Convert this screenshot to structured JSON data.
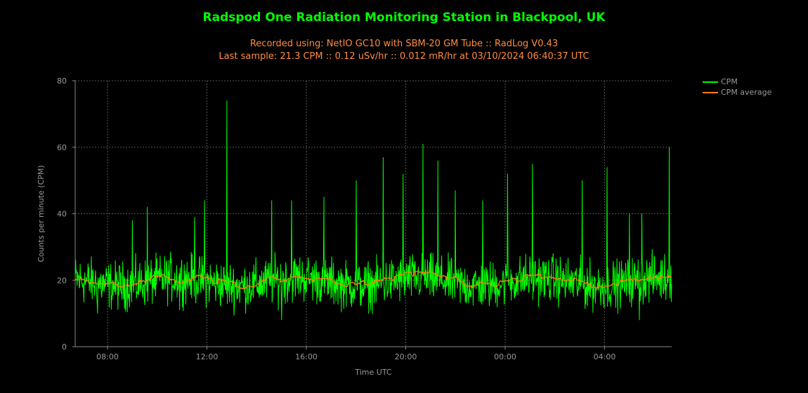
{
  "chart_data": {
    "type": "line",
    "title": "Radspod One Radiation Monitoring Station in Blackpool, UK",
    "subtitle_line1": "Recorded using: NetIO GC10 with SBM-20 GM Tube :: RadLog V0.43",
    "subtitle_line2": "Last sample: 21.3 CPM :: 0.12 uSv/hr :: 0.012 mR/hr at 03/10/2024 06:40:37 UTC",
    "xlabel": "Time UTC",
    "ylabel": "Counts per minute (CPM)",
    "ylim": [
      0,
      80
    ],
    "yticks": [
      "0",
      "20",
      "40",
      "60",
      "80"
    ],
    "xlim_hours": [
      6.7,
      30.7
    ],
    "xticks": [
      {
        "hour": 8,
        "label": "08:00"
      },
      {
        "hour": 12,
        "label": "12:00"
      },
      {
        "hour": 16,
        "label": "16:00"
      },
      {
        "hour": 20,
        "label": "20:00"
      },
      {
        "hour": 24,
        "label": "00:00"
      },
      {
        "hour": 28,
        "label": "04:00"
      }
    ],
    "grid": true,
    "legend_position": "top-right",
    "series": [
      {
        "name": "CPM",
        "color": "#00ff00"
      },
      {
        "name": "CPM average",
        "color": "#ff7f0e"
      }
    ],
    "baseline_cpm": 19.5,
    "spikes": [
      {
        "hour": 9.0,
        "cpm": 38
      },
      {
        "hour": 9.6,
        "cpm": 42
      },
      {
        "hour": 11.5,
        "cpm": 39
      },
      {
        "hour": 11.9,
        "cpm": 44
      },
      {
        "hour": 12.8,
        "cpm": 74
      },
      {
        "hour": 14.6,
        "cpm": 44
      },
      {
        "hour": 15.4,
        "cpm": 44
      },
      {
        "hour": 16.7,
        "cpm": 45
      },
      {
        "hour": 18.0,
        "cpm": 50
      },
      {
        "hour": 19.1,
        "cpm": 57
      },
      {
        "hour": 19.9,
        "cpm": 52
      },
      {
        "hour": 20.7,
        "cpm": 61
      },
      {
        "hour": 21.3,
        "cpm": 56
      },
      {
        "hour": 22.0,
        "cpm": 47
      },
      {
        "hour": 23.1,
        "cpm": 44
      },
      {
        "hour": 24.1,
        "cpm": 52
      },
      {
        "hour": 25.1,
        "cpm": 55
      },
      {
        "hour": 27.1,
        "cpm": 50
      },
      {
        "hour": 28.1,
        "cpm": 54
      },
      {
        "hour": 29.0,
        "cpm": 40
      },
      {
        "hour": 29.5,
        "cpm": 40
      },
      {
        "hour": 30.6,
        "cpm": 60
      }
    ],
    "dips": [
      {
        "hour": 7.6,
        "cpm": 10
      },
      {
        "hour": 10.9,
        "cpm": 11
      },
      {
        "hour": 15.0,
        "cpm": 8
      },
      {
        "hour": 29.4,
        "cpm": 8
      }
    ]
  }
}
